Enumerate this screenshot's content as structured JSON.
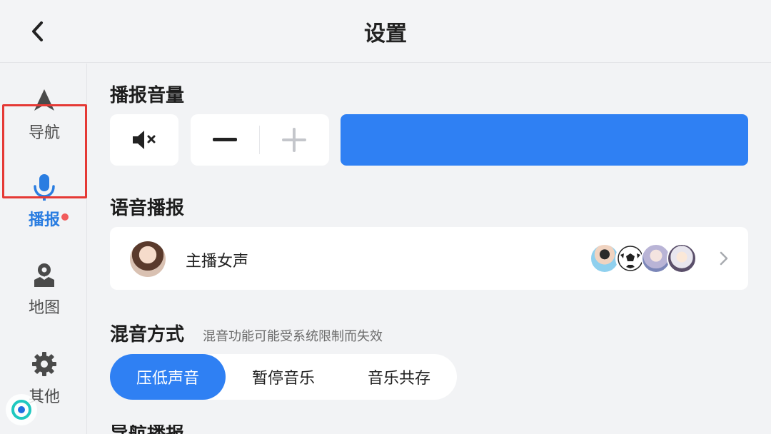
{
  "header": {
    "title": "设置",
    "back_icon": "chevron-left-icon"
  },
  "sidebar": {
    "items": [
      {
        "id": "nav",
        "label": "导航",
        "icon": "navigation-arrow-icon",
        "active": false
      },
      {
        "id": "broadcast",
        "label": "播报",
        "icon": "microphone-icon",
        "active": true
      },
      {
        "id": "map",
        "label": "地图",
        "icon": "map-pin-icon",
        "active": false,
        "badge": "red-dot"
      },
      {
        "id": "other",
        "label": "其他",
        "icon": "gear-icon",
        "active": false
      }
    ]
  },
  "volume": {
    "title": "播报音量",
    "mute_icon": "speaker-mute-icon",
    "minus_icon": "minus-icon",
    "plus_icon": "plus-icon",
    "level": 1.0
  },
  "voice": {
    "title": "语音播报",
    "selected_name": "主播女声",
    "avatars": [
      "voice-avatar-man",
      "voice-avatar-football",
      "voice-avatar-anime-girl",
      "voice-avatar-anime-character"
    ]
  },
  "mix": {
    "title": "混音方式",
    "note": "混音功能可能受系统限制而失效",
    "options": [
      "压低声音",
      "暂停音乐",
      "音乐共存"
    ],
    "selected_index": 0
  },
  "next_section": {
    "title": "导航播报"
  },
  "colors": {
    "accent": "#2f80f3",
    "highlight": "#e53935",
    "badge": "#f15b5b",
    "background": "#f2f3f5"
  }
}
